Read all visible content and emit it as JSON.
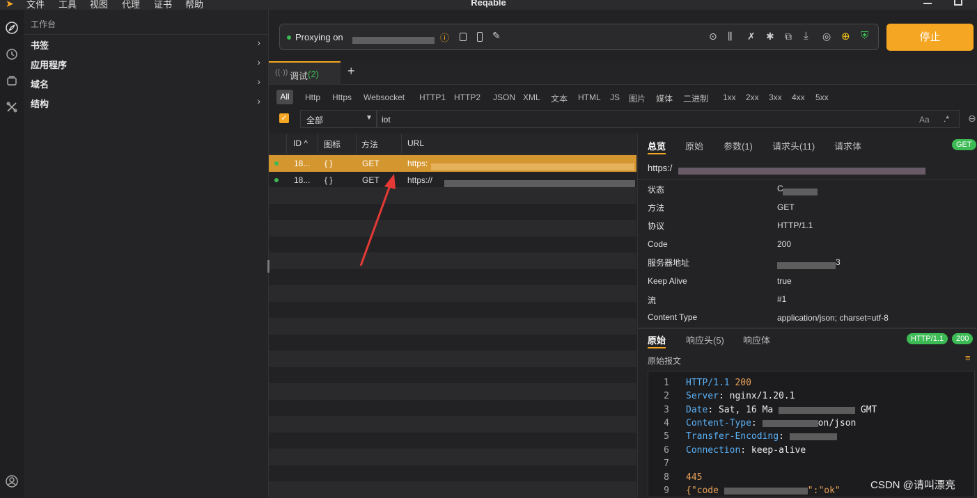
{
  "titlebar": {
    "menus": [
      "文件",
      "工具",
      "视图",
      "代理",
      "证书",
      "帮助"
    ],
    "app_title": "Reqable"
  },
  "sidebar": {
    "header": "工作台",
    "items": [
      {
        "label": "书签"
      },
      {
        "label": "应用程序"
      },
      {
        "label": "域名"
      },
      {
        "label": "结构"
      }
    ]
  },
  "proxybar": {
    "status": "Proxying on",
    "stop_label": "停止"
  },
  "tabs": {
    "debug_label": "调试",
    "debug_count": "(2)",
    "add": "+"
  },
  "filters": [
    "All",
    "Http",
    "Https",
    "Websocket",
    "HTTP1",
    "HTTP2",
    "JSON",
    "XML",
    "文本",
    "HTML",
    "JS",
    "图片",
    "媒体",
    "二进制",
    "1xx",
    "2xx",
    "3xx",
    "4xx",
    "5xx"
  ],
  "search": {
    "scope": "全部",
    "query": "iot",
    "case_toggle": "Aa",
    "regex_toggle": ".*"
  },
  "list": {
    "columns": [
      "ID ^",
      "图标",
      "方法",
      "URL"
    ],
    "rows": [
      {
        "id": "18...",
        "icon": "{ }",
        "method": "GET",
        "url": "https:"
      },
      {
        "id": "18...",
        "icon": "{ }",
        "method": "GET",
        "url": "https://"
      }
    ]
  },
  "detail": {
    "tabs": [
      "总览",
      "原始",
      "参数(1)",
      "请求头(11)",
      "请求体"
    ],
    "method_badge": "GET",
    "url_prefix": "https:/",
    "rows": [
      {
        "k": "状态",
        "v": "C"
      },
      {
        "k": "方法",
        "v": "GET"
      },
      {
        "k": "协议",
        "v": "HTTP/1.1"
      },
      {
        "k": "Code",
        "v": "200"
      },
      {
        "k": "服务器地址",
        "v": "3"
      },
      {
        "k": "Keep Alive",
        "v": "true"
      },
      {
        "k": "流",
        "v": "#1"
      },
      {
        "k": "Content Type",
        "v": "application/json; charset=utf-8"
      }
    ],
    "resp_tabs": [
      "原始",
      "响应头(5)",
      "响应体"
    ],
    "resp_badges": {
      "protocol": "HTTP/1.1",
      "code": "200"
    },
    "raw_label": "原始报文",
    "code_lines": [
      {
        "n": "1",
        "k": "HTTP/1.1",
        "v": " 200"
      },
      {
        "n": "2",
        "k": "Server",
        "v": ": nginx/1.20.1"
      },
      {
        "n": "3",
        "k": "Date",
        "v": ": Sat, 16 Ma"
      },
      {
        "n": "4",
        "k": "Content-Type",
        "v": ":"
      },
      {
        "n": "5",
        "k": "Transfer-Encoding",
        "v": ":"
      },
      {
        "n": "6",
        "k": "Connection",
        "v": ": keep-alive"
      },
      {
        "n": "7",
        "k": "",
        "v": ""
      },
      {
        "n": "8",
        "k": "",
        "v": "445"
      },
      {
        "n": "9",
        "k": "{\"code",
        "v": ""
      }
    ],
    "code_extra": {
      "gmt": "GMT",
      "json": "on/json",
      "ok": "\":\"ok\""
    }
  },
  "watermark": "CSDN @请叫漂亮",
  "colors": {
    "accent": "#f5a623",
    "green": "#3cba54",
    "selected_row": "#d4962f"
  }
}
